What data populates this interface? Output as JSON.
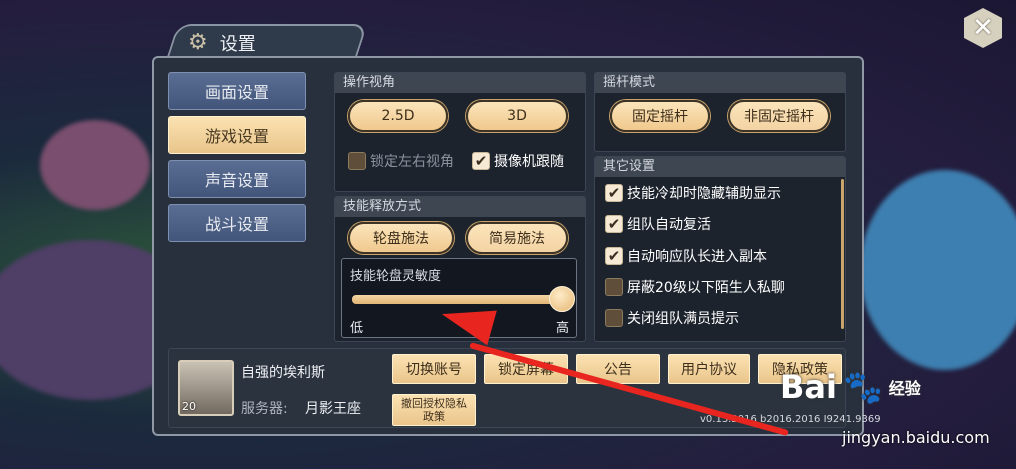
{
  "panel": {
    "title": "设置",
    "close_symbol": "✕"
  },
  "sidebar": {
    "items": [
      {
        "label": "画面设置",
        "active": false
      },
      {
        "label": "游戏设置",
        "active": true
      },
      {
        "label": "声音设置",
        "active": false
      },
      {
        "label": "战斗设置",
        "active": false
      }
    ]
  },
  "camera": {
    "header": "操作视角",
    "options": [
      "2.5D",
      "3D"
    ],
    "lock_label": "锁定左右视角",
    "lock_checked": false,
    "follow_label": "摄像机跟随",
    "follow_checked": true
  },
  "joystick": {
    "header": "摇杆模式",
    "options": [
      "固定摇杆",
      "非固定摇杆"
    ]
  },
  "skill": {
    "header": "技能释放方式",
    "options": [
      "轮盘施法",
      "简易施法"
    ],
    "sensitivity_label": "技能轮盘灵敏度",
    "low_label": "低",
    "high_label": "高",
    "sensitivity_value": 1.0
  },
  "others": {
    "header": "其它设置",
    "items": [
      {
        "label": "技能冷却时隐藏辅助显示",
        "checked": true
      },
      {
        "label": "组队自动复活",
        "checked": true
      },
      {
        "label": "自动响应队长进入副本",
        "checked": true
      },
      {
        "label": "屏蔽20级以下陌生人私聊",
        "checked": false
      },
      {
        "label": "关闭组队满员提示",
        "checked": false
      }
    ]
  },
  "account": {
    "name": "自强的埃利斯",
    "level": "20",
    "server_label": "服务器:",
    "server_name": "月影王座",
    "buttons": [
      "切换账号",
      "锁定屏幕",
      "公告",
      "用户协议",
      "隐私政策"
    ],
    "revoke_label": "撤回授权隐私政策",
    "version": "v0.13.2016 b2016.2016 I9241.9369"
  },
  "watermark": {
    "brand": "Bai",
    "brand_suffix": "经验",
    "url": "jingyan.baidu.com"
  },
  "icons": {
    "settings": "gear-icon",
    "close": "close-icon",
    "check": "check-icon"
  },
  "colors": {
    "accent": "#f0c98d",
    "annotation_arrow": "#e8261f"
  }
}
